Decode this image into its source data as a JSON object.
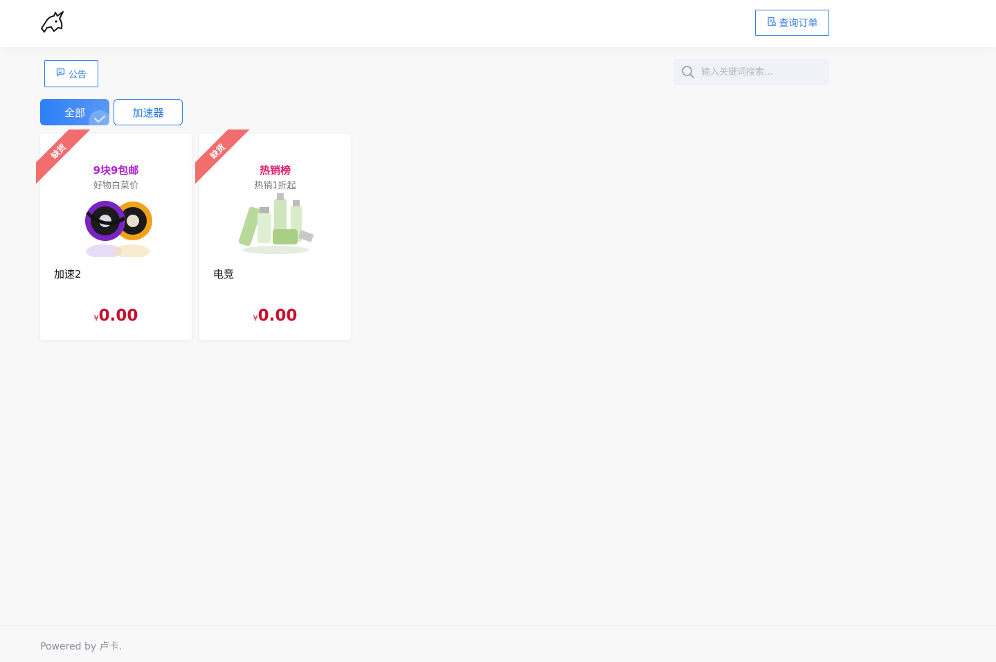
{
  "header": {
    "logo": "unicorn-logo",
    "order_query_label": "查询订单"
  },
  "toolbar": {
    "notice_label": "公告",
    "search_placeholder": "输入关键词搜索..."
  },
  "tabs": [
    {
      "label": "全部",
      "active": true
    },
    {
      "label": "加速器",
      "active": false
    }
  ],
  "products": [
    {
      "ribbon": "缺货",
      "banner_title": "9块9包邮",
      "banner_subtitle": "好物白菜价",
      "name": "加速2",
      "currency": "¥",
      "price": "0.00"
    },
    {
      "ribbon": "缺货",
      "banner_title": "热销榜",
      "banner_subtitle": "热销1折起",
      "name": "电竞",
      "currency": "¥",
      "price": "0.00"
    }
  ],
  "footer": {
    "text": "Powered by 卢卡."
  },
  "colors": {
    "accent": "#2d7be5",
    "price": "#c8102e",
    "ribbon": "#f26d6d"
  }
}
